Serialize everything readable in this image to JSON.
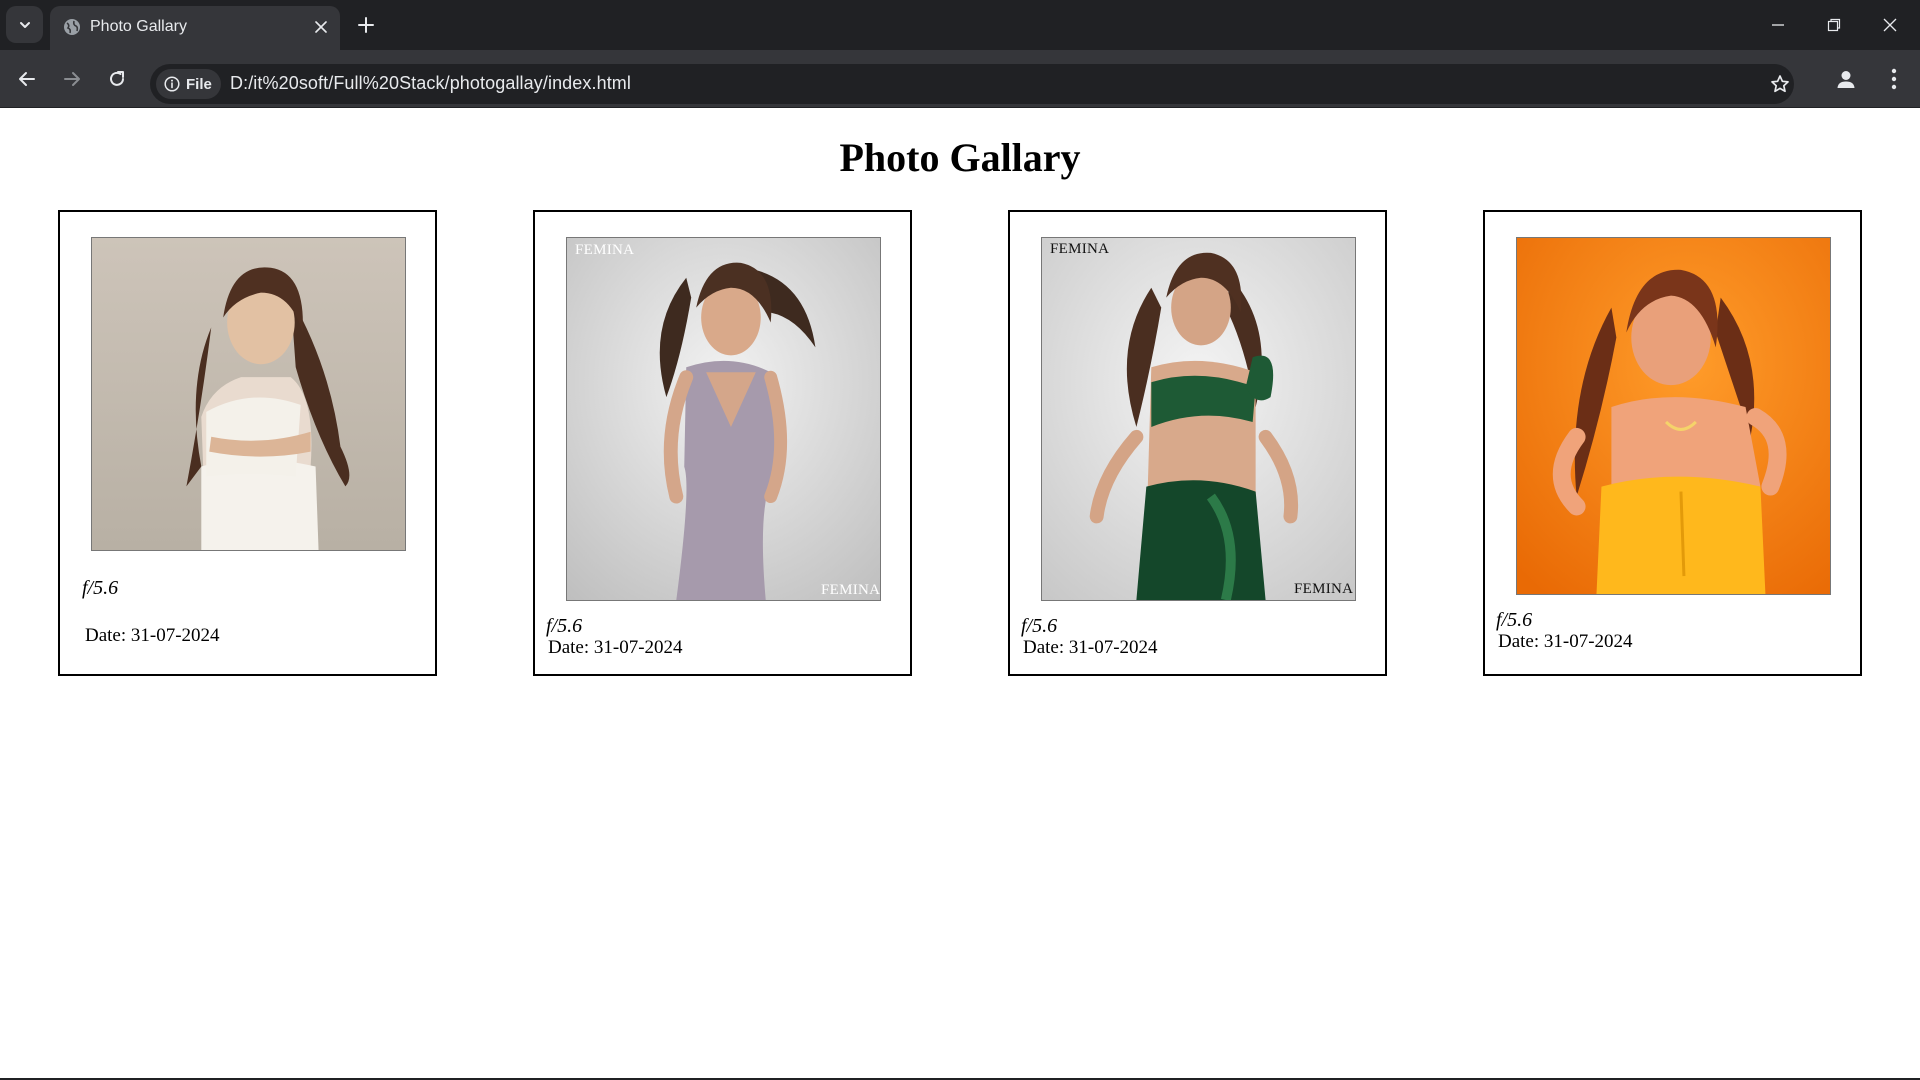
{
  "browser": {
    "tab_title": "Photo Gallary",
    "site_info_label": "File",
    "url": "D:/it%20soft/Full%20Stack/photogallay/index.html"
  },
  "page": {
    "title": "Photo Gallary"
  },
  "gallery": [
    {
      "aperture": "f/5.6",
      "date": "Date: 31-07-2024",
      "watermarks": []
    },
    {
      "aperture": "f/5.6",
      "date": "Date: 31-07-2024",
      "watermarks": [
        "FEMINA",
        "FEMINA"
      ]
    },
    {
      "aperture": "f/5.6",
      "date": "Date: 31-07-2024",
      "watermarks": [
        "FEMINA",
        "FEMINA"
      ]
    },
    {
      "aperture": "f/5.6",
      "date": "Date: 31-07-2024",
      "watermarks": []
    }
  ]
}
